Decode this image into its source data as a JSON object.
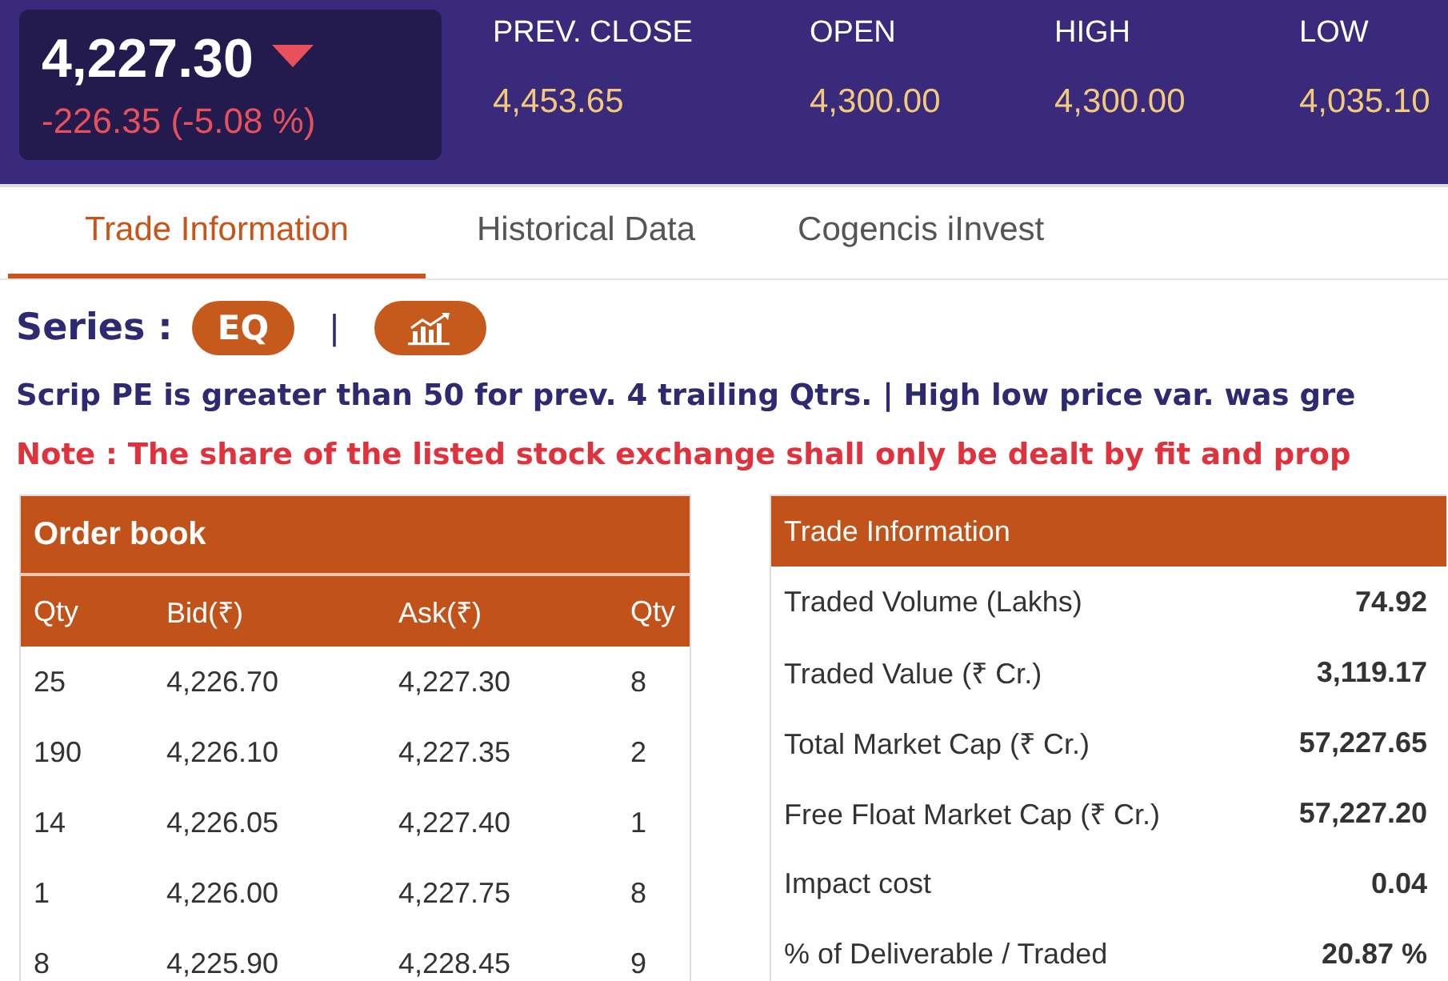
{
  "quote": {
    "price": "4,227.30",
    "falling": true,
    "change": "-226.35 (-5.08 %)"
  },
  "stats": [
    {
      "label": "PREV. CLOSE",
      "value": "4,453.65"
    },
    {
      "label": "OPEN",
      "value": "4,300.00"
    },
    {
      "label": "HIGH",
      "value": "4,300.00"
    },
    {
      "label": "LOW",
      "value": "4,035.10"
    }
  ],
  "tabs": [
    {
      "label": "Trade Information",
      "selected": true
    },
    {
      "label": "Historical Data",
      "selected": false
    },
    {
      "label": "Cogencis iInvest",
      "selected": false
    }
  ],
  "series": {
    "label": "Series :",
    "value": "EQ",
    "separator": "|"
  },
  "info_line": "Scrip PE is greater than 50 for prev. 4 trailing Qtrs. | High low price var. was gre",
  "note_line": "Note : The share of the listed stock exchange shall only be dealt by fit and prop",
  "order_book": {
    "title": "Order book",
    "columns": [
      "Qty",
      "Bid(₹)",
      "Ask(₹)",
      "Qty"
    ],
    "rows": [
      [
        "25",
        "4,226.70",
        "4,227.30",
        "8"
      ],
      [
        "190",
        "4,226.10",
        "4,227.35",
        "2"
      ],
      [
        "14",
        "4,226.05",
        "4,227.40",
        "1"
      ],
      [
        "1",
        "4,226.00",
        "4,227.75",
        "8"
      ],
      [
        "8",
        "4,225.90",
        "4,228.45",
        "9"
      ]
    ]
  },
  "trade_information": {
    "title": "Trade Information",
    "rows": [
      {
        "label": "Traded Volume (Lakhs)",
        "value": "74.92"
      },
      {
        "label": "Traded Value (₹ Cr.)",
        "value": "3,119.17"
      },
      {
        "label": "Total Market Cap (₹ Cr.)",
        "value": "57,227.65"
      },
      {
        "label": "Free Float Market Cap (₹ Cr.)",
        "value": "57,227.20"
      },
      {
        "label": "Impact cost",
        "value": "0.04"
      },
      {
        "label": "% of Deliverable / Traded",
        "value": "20.87 %"
      }
    ]
  }
}
